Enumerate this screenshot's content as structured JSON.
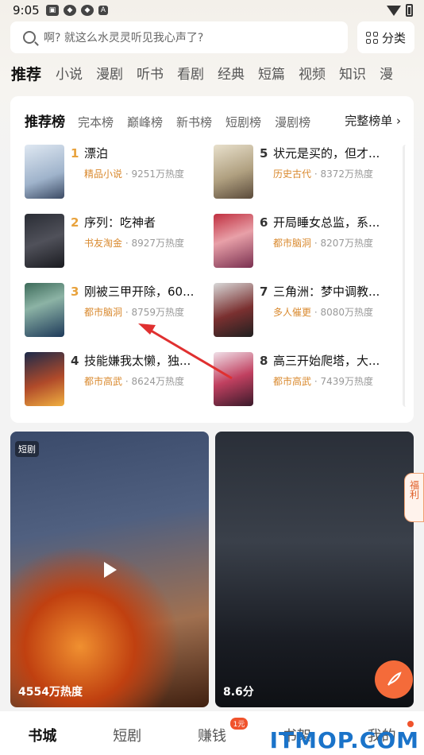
{
  "status_bar": {
    "time": "9:05"
  },
  "search": {
    "placeholder": "啊? 就这么水灵灵听见我心声了?"
  },
  "category_button": {
    "label": "分类"
  },
  "channel_tabs": [
    "推荐",
    "小说",
    "漫剧",
    "听书",
    "看剧",
    "经典",
    "短篇",
    "视频",
    "知识",
    "漫"
  ],
  "ranking": {
    "tabs": [
      "推荐榜",
      "完本榜",
      "巅峰榜",
      "新书榜",
      "短剧榜",
      "漫剧榜"
    ],
    "full_label": "完整榜单 ›",
    "books": [
      {
        "rank": "1",
        "title": "漂泊",
        "tag": "精品小说",
        "heat": "· 9251万热度"
      },
      {
        "rank": "2",
        "title": "序列：吃神者",
        "tag": "书友淘金",
        "heat": "· 8927万热度"
      },
      {
        "rank": "3",
        "title": "刚被三甲开除，60...",
        "tag": "都市脑洞",
        "heat": "· 8759万热度"
      },
      {
        "rank": "4",
        "title": "技能嫌我太懒，独...",
        "tag": "都市高武",
        "heat": "· 8624万热度"
      },
      {
        "rank": "5",
        "title": "状元是买的，但才...",
        "tag": "历史古代",
        "heat": "· 8372万热度"
      },
      {
        "rank": "6",
        "title": "开局睡女总监，系...",
        "tag": "都市脑洞",
        "heat": "· 8207万热度"
      },
      {
        "rank": "7",
        "title": "三角洲：梦中调教...",
        "tag": "多人催更",
        "heat": "· 8080万热度"
      },
      {
        "rank": "8",
        "title": "高三开始爬塔，大...",
        "tag": "都市高武",
        "heat": "· 7439万热度"
      }
    ]
  },
  "feature_cards": [
    {
      "badge": "短剧",
      "footer": "4554万热度"
    },
    {
      "footer": "8.6分"
    }
  ],
  "welfare_tab": {
    "label": "福利"
  },
  "bottom_nav": {
    "items": [
      "书城",
      "短剧",
      "赚钱",
      "书架",
      "我的"
    ],
    "earn_badge": "1元"
  },
  "watermark": {
    "text": "ITMOP.COM"
  },
  "colors": {
    "accent": "#d9892e",
    "rank_top": "#e8a23c",
    "fab": "#f46b3a",
    "badge_red": "#f0532c"
  }
}
